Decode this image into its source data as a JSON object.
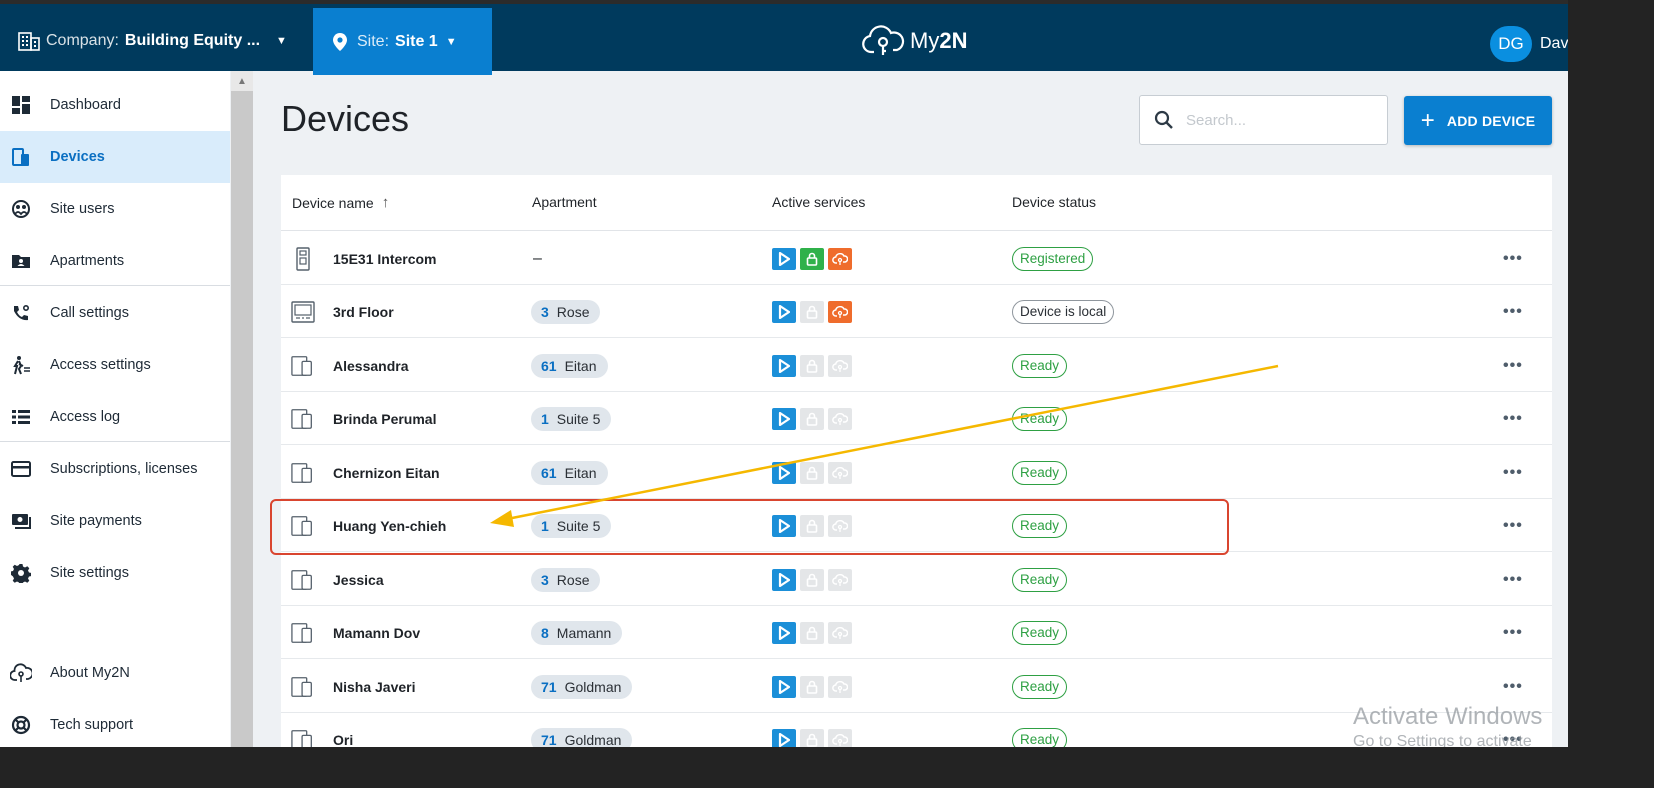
{
  "topbar": {
    "company_label": "Company:",
    "company_value": "Building Equity ...",
    "site_label": "Site:",
    "site_value": "Site 1",
    "app_name_prefix": "My",
    "app_name_suffix": "2N",
    "user_initials": "DG",
    "user_name": "Dav"
  },
  "sidebar": {
    "items": [
      {
        "label": "Dashboard",
        "icon": "dashboard-icon"
      },
      {
        "label": "Devices",
        "icon": "device-icon",
        "active": true
      },
      {
        "label": "Site users",
        "icon": "site-users-icon"
      },
      {
        "label": "Apartments",
        "icon": "apartments-icon"
      },
      {
        "label": "Call settings",
        "icon": "call-settings-icon"
      },
      {
        "label": "Access settings",
        "icon": "access-settings-icon"
      },
      {
        "label": "Access log",
        "icon": "access-log-icon"
      },
      {
        "label": "Subscriptions, licenses",
        "icon": "card-icon"
      },
      {
        "label": "Site payments",
        "icon": "payments-icon"
      },
      {
        "label": "Site settings",
        "icon": "gear-icon"
      },
      {
        "label": "About My2N",
        "icon": "cloud-icon"
      },
      {
        "label": "Tech support",
        "icon": "lifebuoy-icon"
      }
    ]
  },
  "main": {
    "title": "Devices",
    "search_placeholder": "Search...",
    "add_button_label": "ADD DEVICE"
  },
  "table": {
    "columns": [
      "Device name",
      "Apartment",
      "Active services",
      "Device status"
    ],
    "rows": [
      {
        "name": "15E31 Intercom",
        "device_icon": "intercom-icon",
        "apt_num": "",
        "apt_name": "",
        "apt_text": "–",
        "services": [
          "on",
          "on",
          "on"
        ],
        "status": "Registered"
      },
      {
        "name": "3rd Floor",
        "device_icon": "answering-unit-icon",
        "apt_num": "3",
        "apt_name": "Rose",
        "apt_text": "",
        "services": [
          "on",
          "off",
          "on"
        ],
        "status": "Device is local"
      },
      {
        "name": "Alessandra",
        "device_icon": "mobile-devices-icon",
        "apt_num": "61",
        "apt_name": "Eitan",
        "apt_text": "",
        "services": [
          "on",
          "off",
          "off"
        ],
        "status": "Ready"
      },
      {
        "name": "Brinda Perumal",
        "device_icon": "mobile-devices-icon",
        "apt_num": "1",
        "apt_name": "Suite 5",
        "apt_text": "",
        "services": [
          "on",
          "off",
          "off"
        ],
        "status": "Ready"
      },
      {
        "name": "Chernizon Eitan",
        "device_icon": "mobile-devices-icon",
        "apt_num": "61",
        "apt_name": "Eitan",
        "apt_text": "",
        "services": [
          "on",
          "off",
          "off"
        ],
        "status": "Ready"
      },
      {
        "name": "Huang Yen-chieh",
        "device_icon": "mobile-devices-icon",
        "apt_num": "1",
        "apt_name": "Suite 5",
        "apt_text": "",
        "services": [
          "on",
          "off",
          "off"
        ],
        "status": "Ready"
      },
      {
        "name": "Jessica",
        "device_icon": "mobile-devices-icon",
        "apt_num": "3",
        "apt_name": "Rose",
        "apt_text": "",
        "services": [
          "on",
          "off",
          "off"
        ],
        "status": "Ready"
      },
      {
        "name": "Mamann Dov",
        "device_icon": "mobile-devices-icon",
        "apt_num": "8",
        "apt_name": "Mamann",
        "apt_text": "",
        "services": [
          "on",
          "off",
          "off"
        ],
        "status": "Ready"
      },
      {
        "name": "Nisha Javeri",
        "device_icon": "mobile-devices-icon",
        "apt_num": "71",
        "apt_name": "Goldman",
        "apt_text": "",
        "services": [
          "on",
          "off",
          "off"
        ],
        "status": "Ready"
      },
      {
        "name": "Ori",
        "device_icon": "mobile-devices-icon",
        "apt_num": "71",
        "apt_name": "Goldman",
        "apt_text": "",
        "services": [
          "on",
          "off",
          "off"
        ],
        "status": "Ready"
      }
    ],
    "more_label": "•••"
  },
  "watermark": {
    "line1": "Activate Windows",
    "line2": "Go to Settings to activate"
  },
  "colors": {
    "topbar": "#003a5d",
    "accent": "#0a7fd0",
    "status_ready": "#2ea043",
    "service_blue": "#1b8fd8",
    "service_green": "#2fb14a",
    "service_orange": "#ef6c2c",
    "highlight_box": "#d9452f",
    "arrow": "#f5b800"
  }
}
